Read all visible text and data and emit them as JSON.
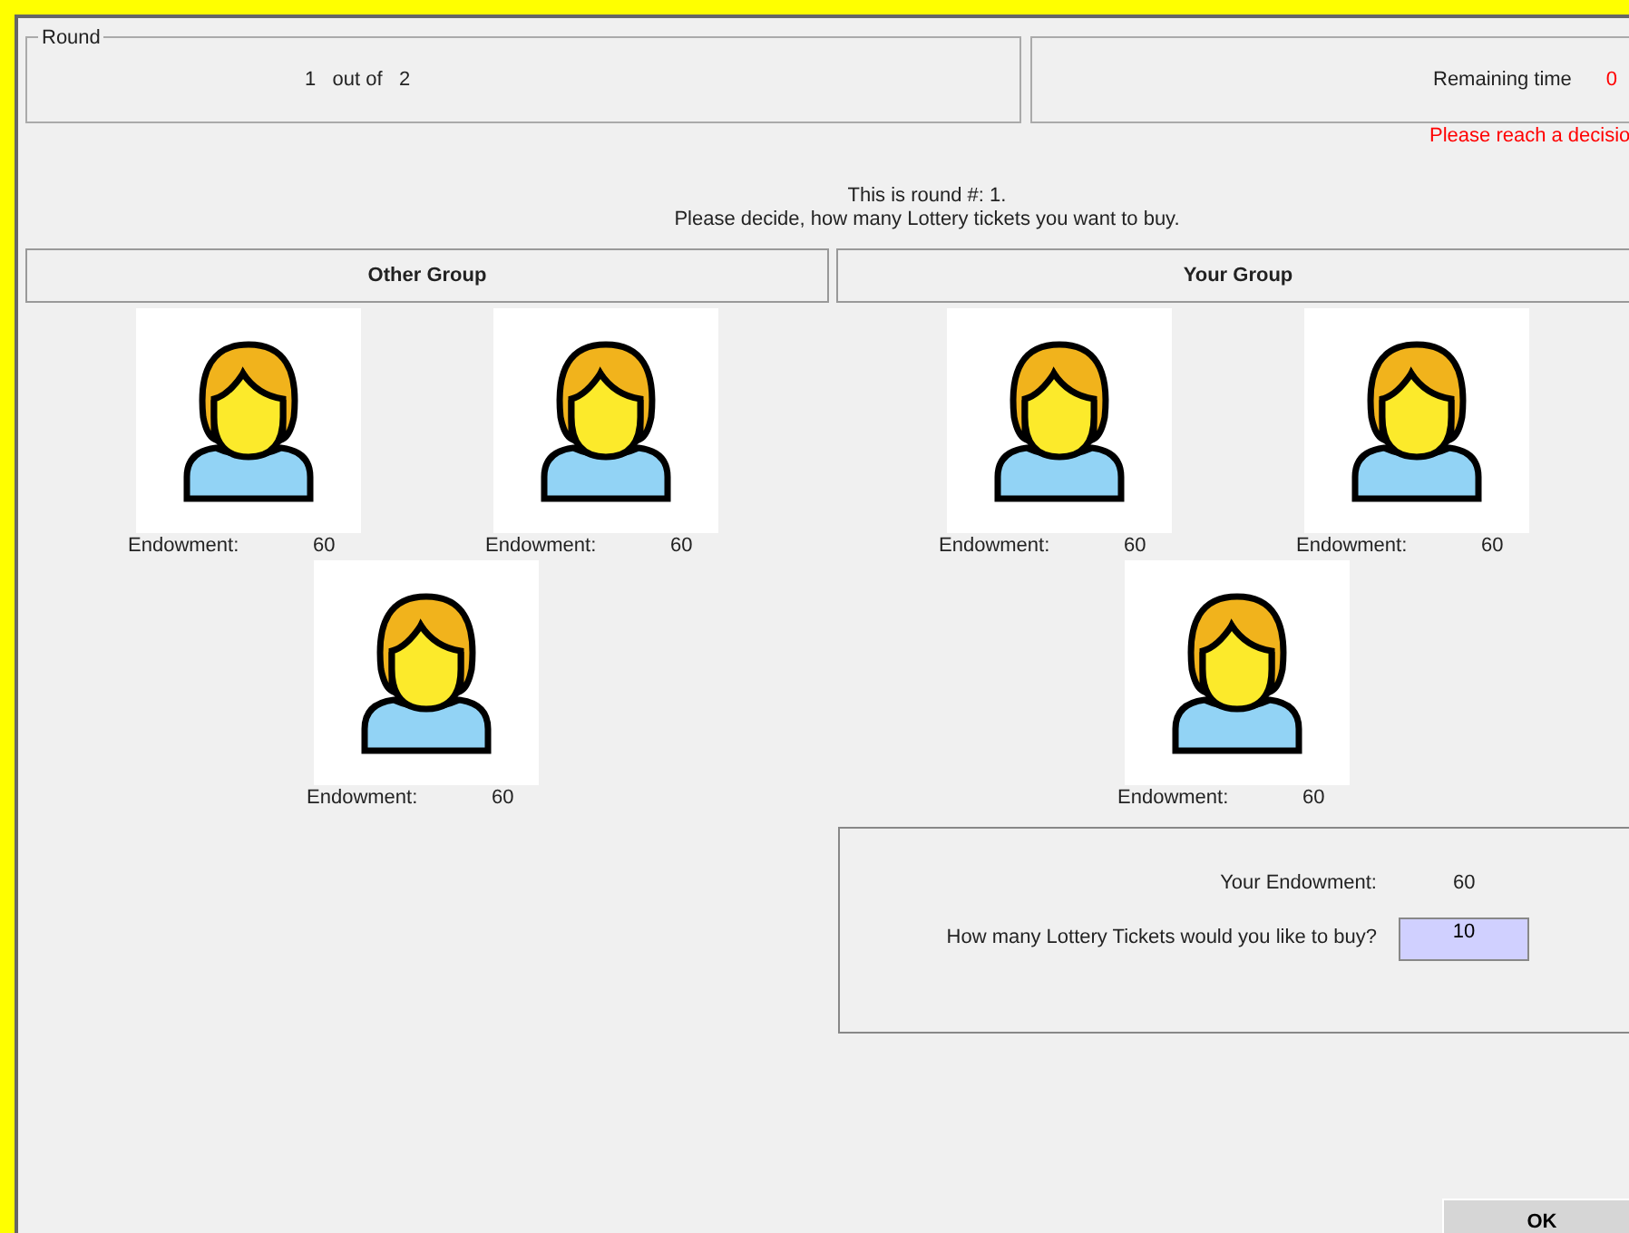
{
  "round_panel": {
    "title": "Round",
    "current": "1",
    "out_of_label": "out of",
    "total": "2"
  },
  "timer": {
    "label": "Remaining time",
    "value": "0",
    "warning": "Please reach a decisio"
  },
  "instructions": [
    "This is round #: 1.",
    "Please decide, how many Lottery tickets you want to buy."
  ],
  "groups": [
    {
      "title": "Other Group",
      "members": [
        {
          "label": "Endowment:",
          "value": "60"
        },
        {
          "label": "Endowment:",
          "value": "60"
        },
        {
          "label": "Endowment:",
          "value": "60"
        }
      ]
    },
    {
      "title": "Your Group",
      "members": [
        {
          "label": "Endowment:",
          "value": "60"
        },
        {
          "label": "Endowment:",
          "value": "60"
        },
        {
          "label": "Endowment:",
          "value": "60"
        }
      ]
    }
  ],
  "decision": {
    "endowment_label": "Your Endowment:",
    "endowment_value": "60",
    "question": "How many Lottery Tickets would you like to buy?",
    "answer": "10"
  },
  "buttons": [
    {
      "label": "OK"
    }
  ]
}
